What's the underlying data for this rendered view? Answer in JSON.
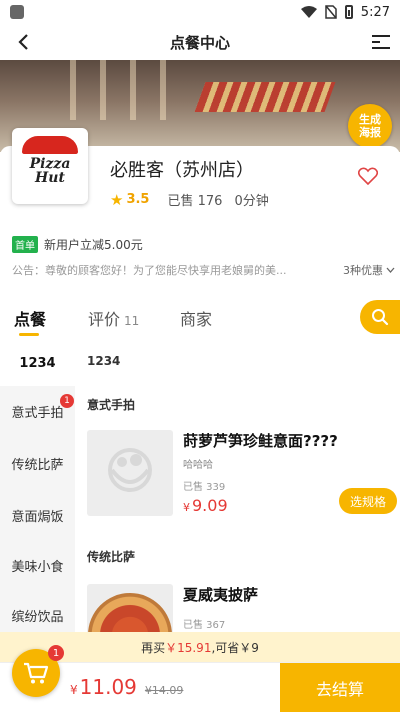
{
  "status_bar": {
    "time": "5:27"
  },
  "header": {
    "title": "点餐中心"
  },
  "banner": {
    "poster_badge": "生成\n海报"
  },
  "store": {
    "logo_text": "Pizza Hut",
    "name": "必胜客（苏州店）",
    "rating": "3.5",
    "sold": "已售 176",
    "delivery_time": "0分钟",
    "promo_tag": "首单",
    "promo_text": "新用户立减5.00元",
    "notice": "公告：尊敬的顾客您好！为了您能尽快享用老娘舅的美...",
    "offers": "3种优惠"
  },
  "tabs": [
    {
      "label": "点餐"
    },
    {
      "label": "评价",
      "count": "11"
    },
    {
      "label": "商家"
    }
  ],
  "sidebar": {
    "first": "1234",
    "items": [
      {
        "label": "意式手拍",
        "badge": "1"
      },
      {
        "label": "传统比萨"
      },
      {
        "label": "意面焗饭"
      },
      {
        "label": "美味小食"
      },
      {
        "label": "缤纷饮品"
      }
    ]
  },
  "content": {
    "top_label": "1234",
    "sections": [
      {
        "title": "意式手拍",
        "product": {
          "name": "莳萝芦笋珍鲑意面????",
          "desc": "哈哈哈",
          "sold": "已售 339",
          "currency": "¥",
          "price": "9.09",
          "button": "选规格"
        }
      },
      {
        "title": "传统比萨",
        "product": {
          "name": "夏威夷披萨",
          "sold": "已售 367"
        }
      }
    ]
  },
  "discount_bar": {
    "pre": "再买",
    "amount": "￥15.91",
    "mid": ",可省",
    "save": "￥9"
  },
  "bottom": {
    "cart_badge": "1",
    "currency": "¥",
    "total": "11.09",
    "original": "¥14.09",
    "checkout": "去结算"
  },
  "colors": {
    "accent": "#f7b500",
    "price": "#e53935",
    "promo_green": "#23b14d"
  }
}
